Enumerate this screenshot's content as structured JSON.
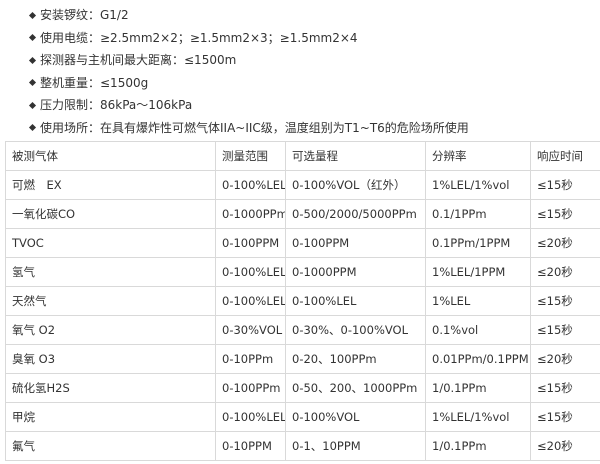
{
  "specs": [
    "安装锣纹：G1/2",
    "使用电缆：≥2.5mm2×2；≥1.5mm2×3；≥1.5mm2×4",
    "探测器与主机间最大距离：≤1500m",
    "整机重量：≤1500g",
    "压力限制：86kPa～106kPa",
    "使用场所：在具有爆炸性可燃气体IIA~IIC级，温度组别为T1~T6的危险场所使用"
  ],
  "table": {
    "headers": [
      "被测气体",
      "测量范围",
      "可选量程",
      "分辨率",
      "响应时间"
    ],
    "rows": [
      [
        "可燃　EX",
        "0-100%LEL",
        "0-100%VOL（红外）",
        "1%LEL/1%vol",
        "≤15秒"
      ],
      [
        "一氧化碳CO",
        "0-1000PPm",
        "0-500/2000/5000PPm",
        "0.1/1PPm",
        "≤15秒"
      ],
      [
        "TVOC",
        "0-100PPM",
        "0-100PPM",
        "0.1PPm/1PPM",
        "≤20秒"
      ],
      [
        "氢气",
        "0-100%LEL",
        "0-1000PPM",
        "1%LEL/1PPM",
        "≤20秒"
      ],
      [
        "天然气",
        "0-100%LEL",
        "0-100%LEL",
        "1%LEL",
        "≤15秒"
      ],
      [
        "氧气 O2",
        "0-30%VOL",
        "0-30%、0-100%VOL",
        "0.1%vol",
        "≤15秒"
      ],
      [
        "臭氧 O3",
        "0-10PPm",
        "0-20、100PPm",
        "0.01PPm/0.1PPM",
        "≤20秒"
      ],
      [
        "硫化氢H2S",
        "0-100PPm",
        "0-50、200、1000PPm",
        "1/0.1PPm",
        "≤15秒"
      ],
      [
        "甲烷",
        "0-100%LEL",
        "0-100%VOL",
        "1%LEL/1%vol",
        "≤15秒"
      ],
      [
        "氟气",
        "0-10PPM",
        "0-1、10PPM",
        "1/0.1PPm",
        "≤20秒"
      ]
    ]
  }
}
